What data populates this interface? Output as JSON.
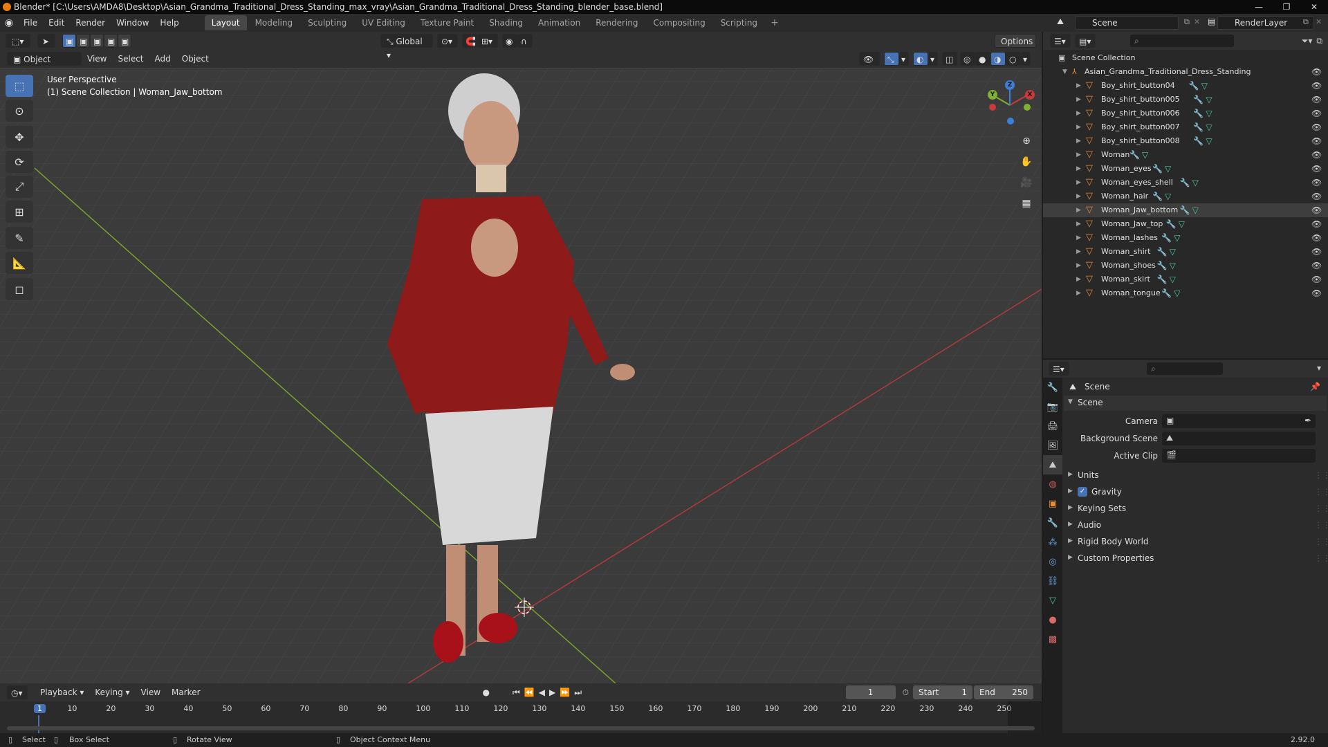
{
  "window": {
    "title": "Blender* [C:\\Users\\AMDA8\\Desktop\\Asian_Grandma_Traditional_Dress_Standing_max_vray\\Asian_Grandma_Traditional_Dress_Standing_blender_base.blend]",
    "controls": [
      "—",
      "❐",
      "✕"
    ]
  },
  "menu": [
    "File",
    "Edit",
    "Render",
    "Window",
    "Help"
  ],
  "workspaces": [
    "Layout",
    "Modeling",
    "Sculpting",
    "UV Editing",
    "Texture Paint",
    "Shading",
    "Animation",
    "Rendering",
    "Compositing",
    "Scripting"
  ],
  "active_workspace": "Layout",
  "scene_name": "Scene",
  "render_layer": "RenderLayer",
  "viewport_header": {
    "mode": "Object Mode",
    "menus": [
      "View",
      "Select",
      "Add",
      "Object"
    ],
    "transform_orientation": "Global",
    "options": "Options"
  },
  "viewport": {
    "perspective": "User Perspective",
    "collection_info": "(1) Scene Collection | Woman_Jaw_bottom",
    "gizmo_axes": [
      "X",
      "Y",
      "Z"
    ]
  },
  "outliner": {
    "root": "Scene Collection",
    "collection": "Asian_Grandma_Traditional_Dress_Standing",
    "items": [
      "Boy_shirt_button04",
      "Boy_shirt_button005",
      "Boy_shirt_button006",
      "Boy_shirt_button007",
      "Boy_shirt_button008",
      "Woman",
      "Woman_eyes",
      "Woman_eyes_shell",
      "Woman_hair",
      "Woman_Jaw_bottom",
      "Woman_Jaw_top",
      "Woman_lashes",
      "Woman_shirt",
      "Woman_shoes",
      "Woman_skirt",
      "Woman_tongue"
    ],
    "selected": "Woman_Jaw_bottom"
  },
  "properties": {
    "context": "Scene",
    "panel": "Scene",
    "fields": [
      {
        "label": "Camera",
        "value": ""
      },
      {
        "label": "Background Scene",
        "value": ""
      },
      {
        "label": "Active Clip",
        "value": ""
      }
    ],
    "subpanels": [
      "Units",
      "Gravity",
      "Keying Sets",
      "Audio",
      "Rigid Body World",
      "Custom Properties"
    ],
    "gravity_enabled": true
  },
  "timeline": {
    "menus": [
      "Playback",
      "Keying",
      "View",
      "Marker"
    ],
    "current_frame": "1",
    "start_label": "Start",
    "start": "1",
    "end_label": "End",
    "end": "250",
    "ruler": [
      "1",
      "10",
      "20",
      "30",
      "40",
      "50",
      "60",
      "70",
      "80",
      "90",
      "100",
      "110",
      "120",
      "130",
      "140",
      "150",
      "160",
      "170",
      "180",
      "190",
      "200",
      "210",
      "220",
      "230",
      "240",
      "250"
    ]
  },
  "statusbar": {
    "select": "Select",
    "box_select": "Box Select",
    "rotate_view": "Rotate View",
    "context_menu": "Object Context Menu",
    "version": "2.92.0"
  },
  "colors": {
    "accent": "#4772b3",
    "x_axis": "#c83b3b",
    "y_axis": "#80b030",
    "z_axis": "#3a7fd8",
    "mesh_icon": "#e58c35"
  }
}
